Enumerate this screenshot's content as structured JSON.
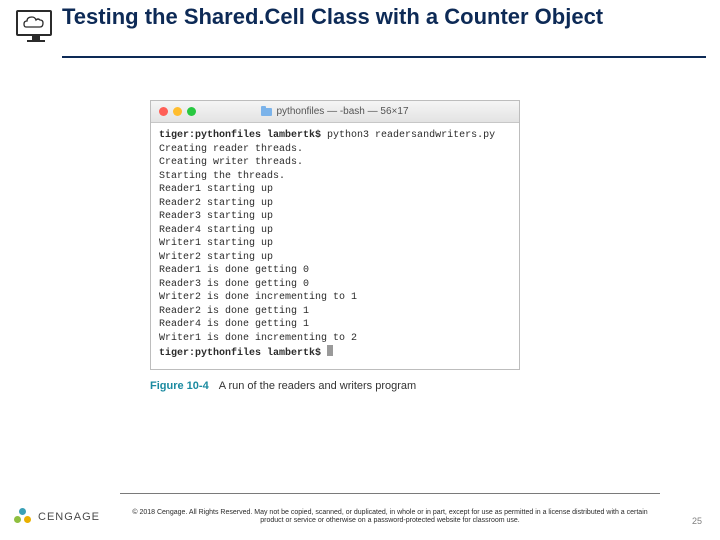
{
  "title": "Testing the Shared.Cell Class with a Counter Object",
  "terminal": {
    "window_title": "pythonfiles — -bash — 56×17",
    "folder_label": "pythonfiles",
    "prompt_host": "tiger:pythonfiles lambertk$",
    "command": "python3 readersandwriters.py",
    "lines": [
      "Creating reader threads.",
      "Creating writer threads.",
      "Starting the threads.",
      "Reader1 starting up",
      "Reader2 starting up",
      "Reader3 starting up",
      "Reader4 starting up",
      "Writer1 starting up",
      "Writer2 starting up",
      "Reader1 is done getting 0",
      "Reader3 is done getting 0",
      "Writer2 is done incrementing to 1",
      "Reader2 is done getting 1",
      "Reader4 is done getting 1",
      "Writer1 is done incrementing to 2"
    ],
    "final_prompt": "tiger:pythonfiles lambertk$"
  },
  "figure": {
    "label": "Figure 10-4",
    "caption": "A run of the readers and writers program"
  },
  "footer": {
    "copyright": "© 2018 Cengage. All Rights Reserved. May not be copied, scanned, or duplicated, in whole or in part, except for use as permitted in a license distributed with a certain product or service or otherwise on a password-protected website for classroom use."
  },
  "brand": "CENGAGE",
  "page_number": "25"
}
